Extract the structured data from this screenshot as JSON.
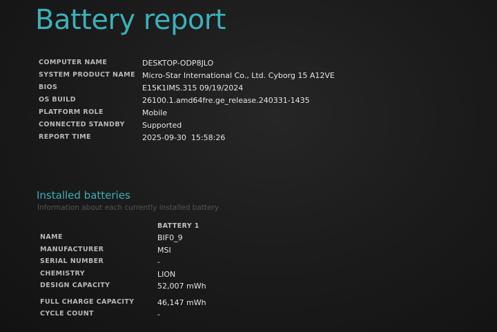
{
  "report": {
    "title": "Battery report"
  },
  "system_info": [
    {
      "label": "COMPUTER NAME",
      "value": "DESKTOP-ODP8JLO"
    },
    {
      "label": "SYSTEM PRODUCT NAME",
      "value": "Micro-Star International Co., Ltd. Cyborg 15 A12VE"
    },
    {
      "label": "BIOS",
      "value": "E15K1IMS.315 09/19/2024"
    },
    {
      "label": "OS BUILD",
      "value": "26100.1.amd64fre.ge_release.240331-1435"
    },
    {
      "label": "PLATFORM ROLE",
      "value": "Mobile"
    },
    {
      "label": "CONNECTED STANDBY",
      "value": "Supported"
    },
    {
      "label": "REPORT TIME",
      "value": "2025-09-30  15:58:26"
    }
  ],
  "installed_batteries": {
    "title": "Installed batteries",
    "subtitle": "Information about each currently installed battery",
    "column_header": "BATTERY 1",
    "rows": [
      {
        "label": "NAME",
        "value": "BIF0_9"
      },
      {
        "label": "MANUFACTURER",
        "value": "MSI"
      },
      {
        "label": "SERIAL NUMBER",
        "value": "-"
      },
      {
        "label": "CHEMISTRY",
        "value": "LION"
      },
      {
        "label": "DESIGN CAPACITY",
        "value": "52,007 mWh"
      },
      {
        "label": "FULL CHARGE CAPACITY",
        "value": "46,147 mWh"
      },
      {
        "label": "CYCLE COUNT",
        "value": "-"
      }
    ]
  }
}
